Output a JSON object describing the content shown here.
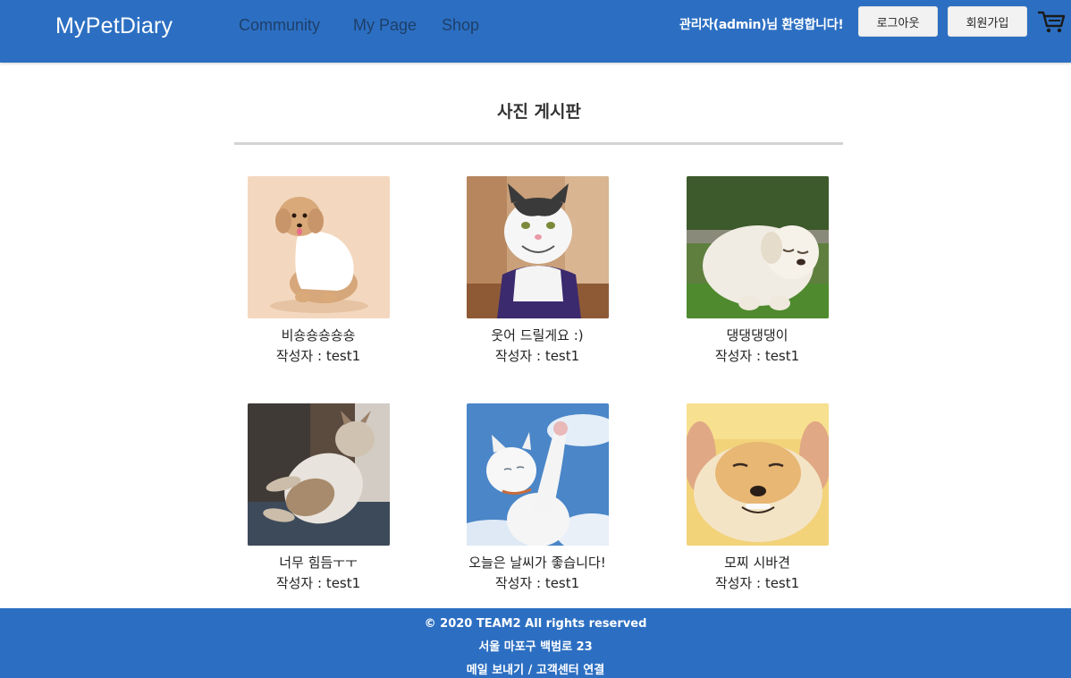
{
  "header": {
    "brand": "MyPetDiary",
    "nav": {
      "community": "Community",
      "mypage": "My Page",
      "shop": "Shop"
    },
    "welcome": "관리자(admin)님 환영합니다!",
    "logout_label": "로그아웃",
    "signup_label": "회원가입",
    "cart_icon": "cart-icon"
  },
  "main": {
    "title": "사진 게시판",
    "posts": [
      {
        "title": "비숑숑숑숑숑",
        "author": "작성자 : test1"
      },
      {
        "title": "웃어 드릴게요 :)",
        "author": "작성자 : test1"
      },
      {
        "title": "댕댕댕댕이",
        "author": "작성자 : test1"
      },
      {
        "title": "너무 힘듬ㅜㅜ",
        "author": "작성자 : test1"
      },
      {
        "title": "오늘은 날씨가 좋습니다!",
        "author": "작성자 : test1"
      },
      {
        "title": "모찌 시바견",
        "author": "작성자 : test1"
      }
    ]
  },
  "footer": {
    "copyright": "© 2020 TEAM2 All rights reserved",
    "address": "서울 마포구 백범로 23",
    "mail_link": "메일 보내기",
    "separator": " / ",
    "support_link": "고객센터 연결"
  },
  "colors": {
    "header_bg": "#2c6fc2",
    "footer_bg": "#2c6fc2",
    "nav_text": "#1e3f6a"
  }
}
